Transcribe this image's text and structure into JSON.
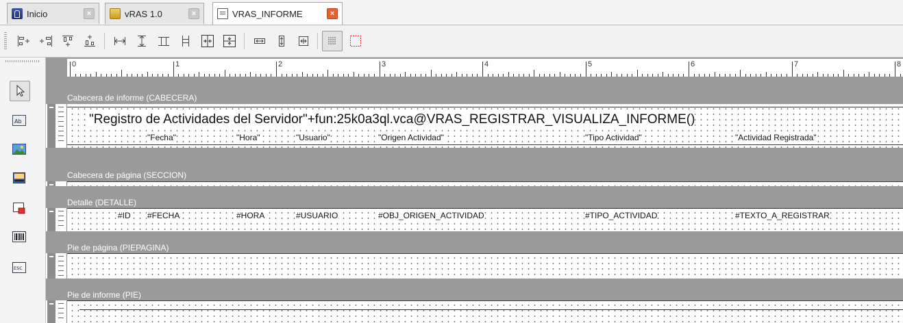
{
  "tabs": [
    {
      "label": "Inicio",
      "icon": "home-icon",
      "active": false
    },
    {
      "label": "vRAS 1.0",
      "icon": "vras-icon",
      "active": false
    },
    {
      "label": "VRAS_INFORME",
      "icon": "report-icon",
      "active": true
    }
  ],
  "ruler": {
    "labels": [
      "0",
      "1",
      "2",
      "3",
      "4",
      "5",
      "6",
      "7",
      "8"
    ]
  },
  "bands": {
    "cabecera": {
      "title": "Cabecera de informe (CABECERA)"
    },
    "seccion": {
      "title": "Cabecera de página (SECCION)"
    },
    "detalle": {
      "title": "Detalle (DETALLE)"
    },
    "piepagina": {
      "title": "Pie de página (PIEPAGINA)"
    },
    "pie": {
      "title": "Pie de informe (PIE)"
    }
  },
  "report": {
    "title_expr": "\"Registro de Actividades del Servidor\"+fun:25k0a3ql.vca@VRAS_REGISTRAR_VISUALIZA_INFORME()",
    "headers": [
      "\"Fecha\"",
      "\"Hora\"",
      "\"Usuario\"",
      "\"Origen Actividad\"",
      "\"Tipo Actividad\"",
      "\"Actividad Registrada\""
    ],
    "detail_fields": [
      "#ID",
      "#FECHA",
      "#HORA",
      "#USUARIO",
      "#OBJ_ORIGEN_ACTIVIDAD",
      "#TIPO_ACTIVIDAD",
      "#TEXTO_A_REGISTRAR"
    ]
  },
  "colors": {
    "active_close": "#e8612c",
    "band_background": "#9a9a9a"
  }
}
